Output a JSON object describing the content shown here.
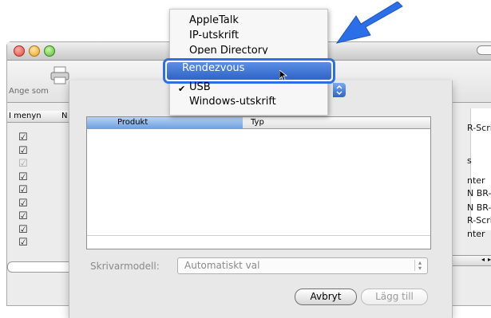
{
  "background_window": {
    "toolbar_label": "Ange som",
    "list_header": {
      "col_menu": "I menyn",
      "col_n": "N"
    },
    "checkboxes": [
      {
        "checked": true,
        "dim": false
      },
      {
        "checked": true,
        "dim": false
      },
      {
        "checked": true,
        "dim": true
      },
      {
        "checked": true,
        "dim": false
      },
      {
        "checked": true,
        "dim": false
      },
      {
        "checked": true,
        "dim": false
      },
      {
        "checked": true,
        "dim": false
      },
      {
        "checked": true,
        "dim": false
      },
      {
        "checked": true,
        "dim": false
      }
    ],
    "right_column_texts": [
      "R-Script",
      "s",
      "nter",
      "N BR-Scri",
      "N BR-Scri",
      "R-Script",
      "nter"
    ]
  },
  "sheet": {
    "table_headers": {
      "product": "Produkt",
      "type": "Typ"
    },
    "model_label": "Skrivarmodell:",
    "model_value": "Automatiskt val",
    "cancel_label": "Avbryt",
    "add_label": "Lägg till"
  },
  "popup_menu": {
    "items": [
      {
        "label": "AppleTalk",
        "checked": false
      },
      {
        "label": "IP-utskrift",
        "checked": false
      },
      {
        "label": "Open Directory",
        "checked": false
      },
      {
        "label": "Rendezvous",
        "checked": false,
        "highlighted": true
      },
      {
        "label": "USB",
        "checked": true
      },
      {
        "label": "Windows-utskrift",
        "checked": false
      }
    ]
  },
  "colors": {
    "highlight": "#2f63c6",
    "callout_arrow": "#2a6ee8"
  },
  "icons": [
    "printer-icon",
    "checkmark-icon",
    "mouse-pointer-icon",
    "callout-arrow-icon",
    "popup-chevron-icon"
  ]
}
